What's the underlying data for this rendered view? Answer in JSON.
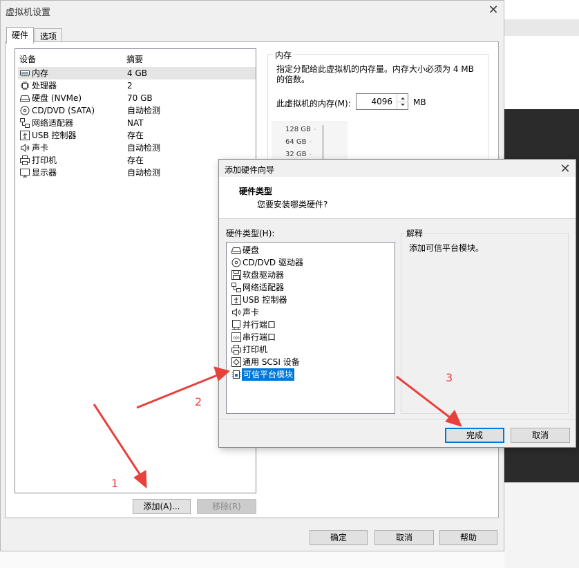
{
  "main_dialog": {
    "title": "虚拟机设置",
    "tabs": [
      {
        "label": "硬件"
      },
      {
        "label": "选项"
      }
    ],
    "device_table": {
      "headers": [
        "设备",
        "摘要"
      ],
      "rows": [
        {
          "icon": "memory-icon",
          "device": "内存",
          "summary": "4 GB"
        },
        {
          "icon": "cpu-icon",
          "device": "处理器",
          "summary": "2"
        },
        {
          "icon": "hard-disk-icon",
          "device": "硬盘 (NVMe)",
          "summary": "70 GB"
        },
        {
          "icon": "cd-dvd-icon",
          "device": "CD/DVD (SATA)",
          "summary": "自动检测"
        },
        {
          "icon": "network-adapter-icon",
          "device": "网络适配器",
          "summary": "NAT"
        },
        {
          "icon": "usb-controller-icon",
          "device": "USB 控制器",
          "summary": "存在"
        },
        {
          "icon": "sound-card-icon",
          "device": "声卡",
          "summary": "自动检测"
        },
        {
          "icon": "printer-icon",
          "device": "打印机",
          "summary": "存在"
        },
        {
          "icon": "display-icon",
          "device": "显示器",
          "summary": "自动检测"
        }
      ]
    },
    "add_button": "添加(A)...",
    "remove_button": "移除(R)",
    "memory": {
      "group_title": "内存",
      "description": "指定分配给此虚拟机的内存量。内存大小必须为 4 MB 的倍数。",
      "label": "此虚拟机的内存(M):",
      "value": "4096",
      "unit": "MB",
      "scale_labels": [
        "128 GB",
        "64 GB",
        "32 GB"
      ]
    },
    "ok_button": "确定",
    "cancel_button": "取消",
    "help_button": "帮助"
  },
  "wizard": {
    "title": "添加硬件向导",
    "heading": "硬件类型",
    "question": "您要安装哪类硬件?",
    "list_label": "硬件类型(H):",
    "items": [
      {
        "icon": "hard-disk-icon",
        "label": "硬盘"
      },
      {
        "icon": "cd-dvd-icon",
        "label": "CD/DVD 驱动器"
      },
      {
        "icon": "floppy-icon",
        "label": "软盘驱动器"
      },
      {
        "icon": "network-adapter-icon",
        "label": "网络适配器"
      },
      {
        "icon": "usb-controller-icon",
        "label": "USB 控制器"
      },
      {
        "icon": "sound-card-icon",
        "label": "声卡"
      },
      {
        "icon": "parallel-port-icon",
        "label": "并行端口"
      },
      {
        "icon": "serial-port-icon",
        "label": "串行端口"
      },
      {
        "icon": "printer-icon",
        "label": "打印机"
      },
      {
        "icon": "scsi-device-icon",
        "label": "通用 SCSI 设备"
      },
      {
        "icon": "tpm-icon",
        "label": "可信平台模块",
        "selected": true
      }
    ],
    "explanation_title": "解释",
    "explanation_text": "添加可信平台模块。",
    "finish_button": "完成",
    "cancel_button": "取消"
  },
  "annotations": [
    "1",
    "2",
    "3"
  ],
  "colors": {
    "selection": "#0078d7",
    "annotation": "#e8403a",
    "dialog_bg": "#f0f0f0"
  }
}
